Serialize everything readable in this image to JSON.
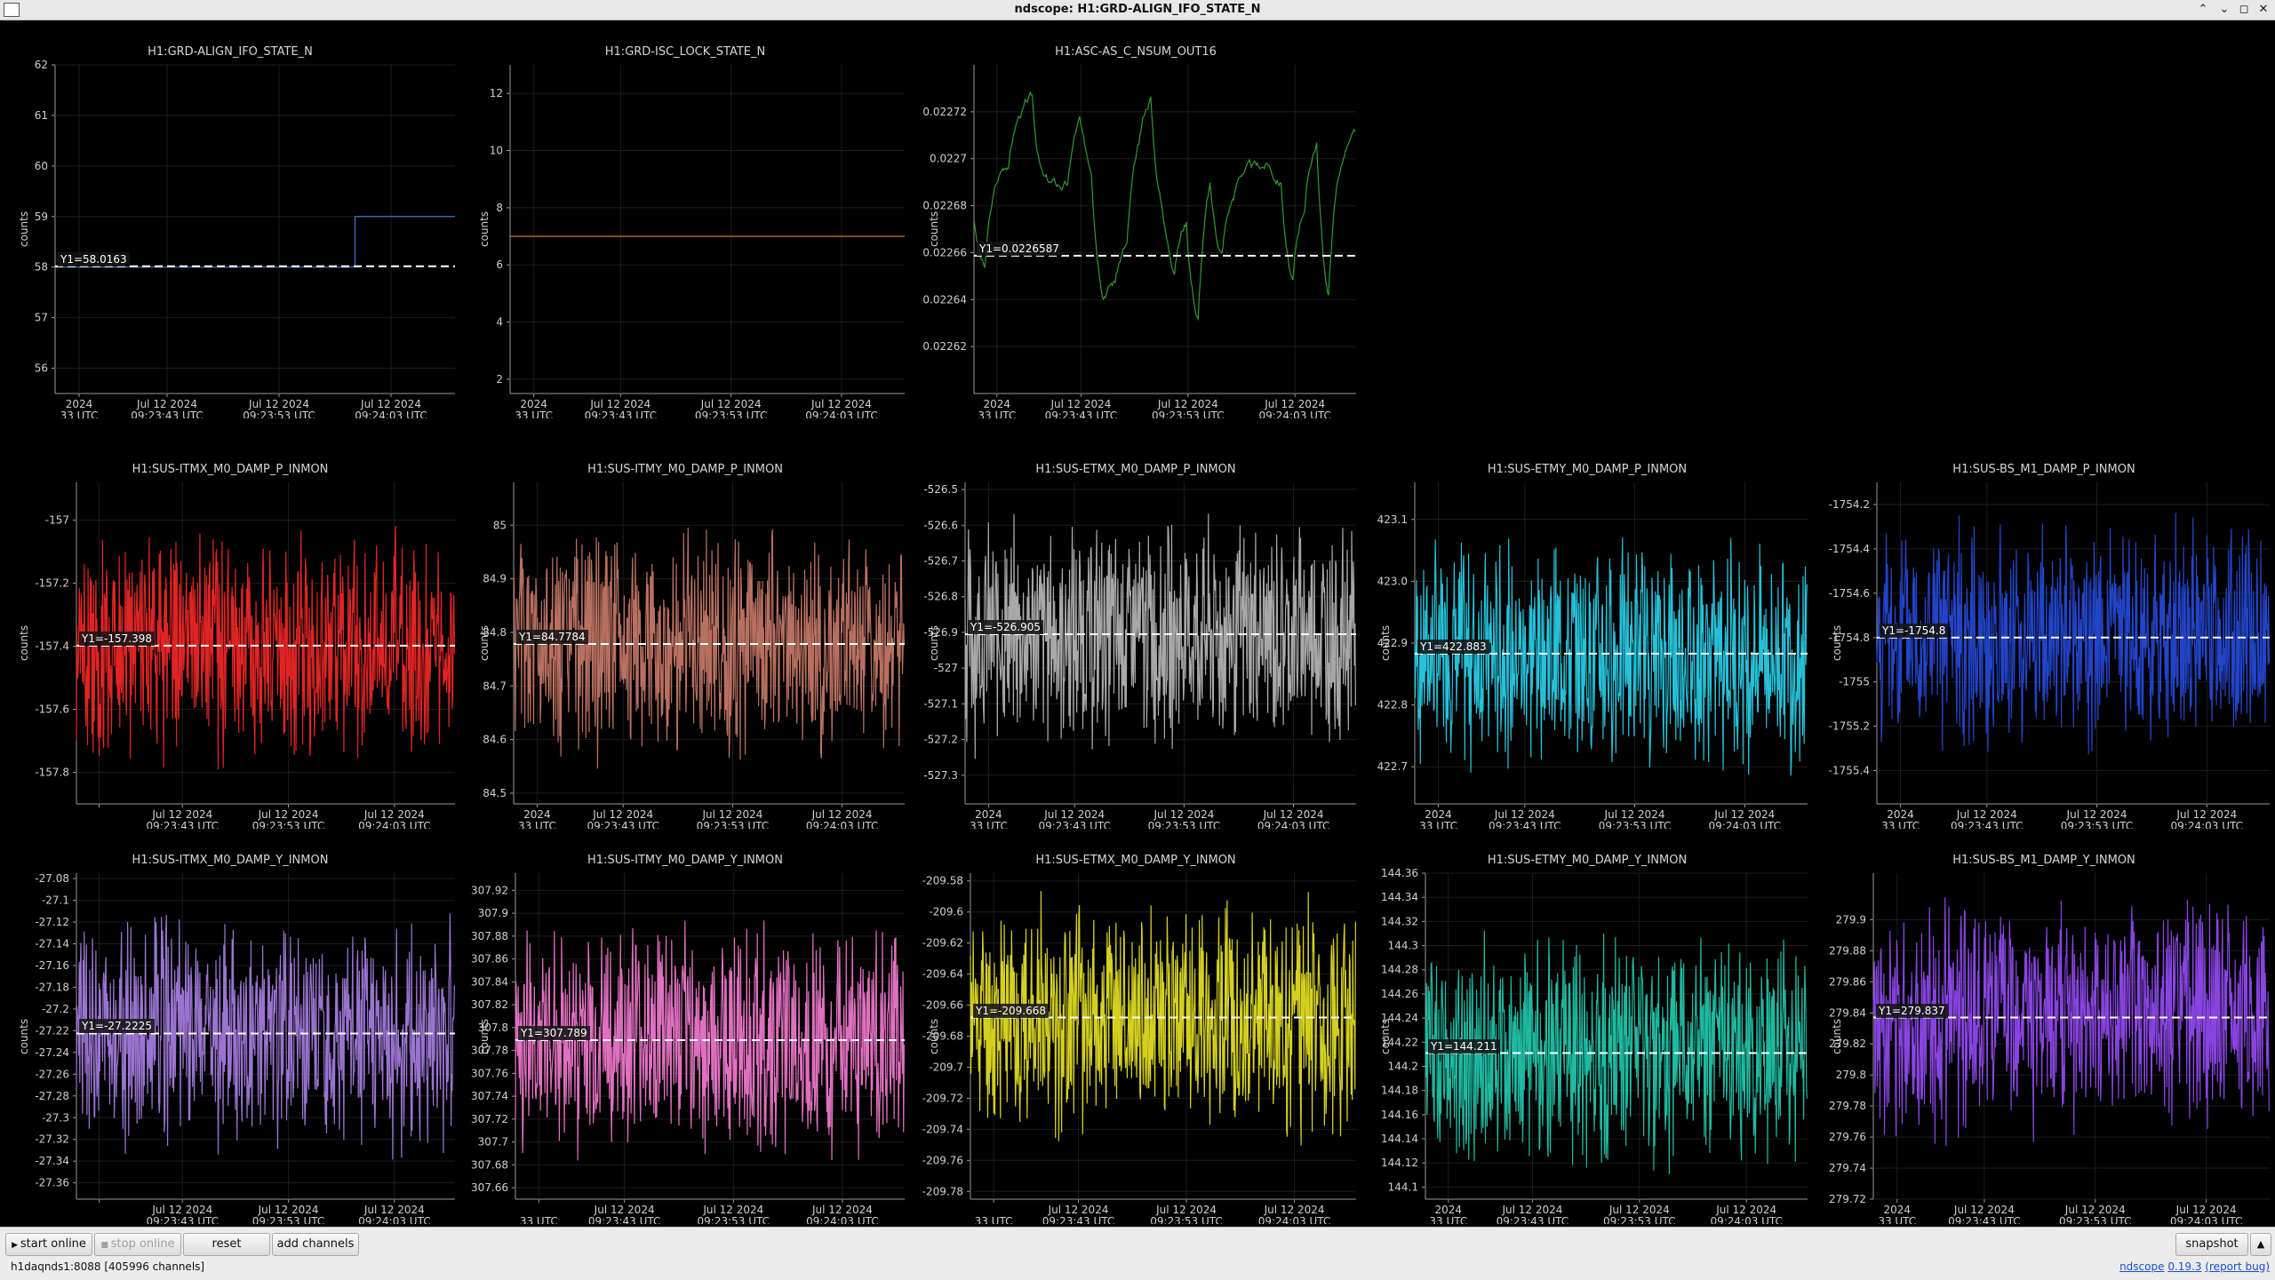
{
  "window": {
    "title": "ndscope: H1:GRD-ALIGN_IFO_STATE_N"
  },
  "ylabel_text": "counts",
  "plots": [
    {
      "title": "H1:GRD-ALIGN_IFO_STATE_N",
      "color": "#3f78c8",
      "kind": "step",
      "ymin": 55.5,
      "ymax": 62,
      "yticks": [
        "56",
        "57",
        "58",
        "59",
        "60",
        "61",
        "62"
      ],
      "cursor": 58.0163,
      "cursor_label": "Y1=58.0163",
      "seed": 1,
      "xticks": [
        "2024",
        "Jul 12 2024",
        "Jul 12 2024",
        "Jul 12 2024"
      ],
      "xsub": [
        "33 UTC",
        "09:23:43 UTC",
        "09:23:53 UTC",
        "09:24:03 UTC"
      ],
      "step_levels": [
        58,
        59
      ],
      "step_at": 0.75
    },
    {
      "title": "H1:GRD-ISC_LOCK_STATE_N",
      "color": "#e08a2a",
      "kind": "flat",
      "ymin": 1.5,
      "ymax": 13,
      "yticks": [
        "2",
        "4",
        "6",
        "8",
        "10",
        "12"
      ],
      "flat_value": 7,
      "cursor": null,
      "cursor_label": "",
      "seed": 2,
      "xticks": [
        "2024",
        "Jul 12 2024",
        "Jul 12 2024",
        "Jul 12 2024"
      ],
      "xsub": [
        "33 UTC",
        "09:23:43 UTC",
        "09:23:53 UTC",
        "09:24:03 UTC"
      ]
    },
    {
      "title": "H1:ASC-AS_C_NSUM_OUT16",
      "color": "#2f9a2f",
      "kind": "smooth",
      "ymin": 0.0226,
      "ymax": 0.02274,
      "yticks": [
        "0.02262",
        "0.02264",
        "0.02266",
        "0.02268",
        "0.0227",
        "0.02272"
      ],
      "cursor": 0.0226587,
      "cursor_label": "Y1=0.0226587",
      "seed": 3,
      "xticks": "2024",
      "xticks_list": [
        "2024",
        "Jul 12 2024",
        "Jul 12 2024",
        "Jul 12 2024"
      ],
      "xsub": [
        "33 UTC",
        "09:23:43 UTC",
        "09:23:53 UTC",
        "09:24:03 UTC"
      ]
    },
    {
      "title": "H1:SUS-ITMX_M0_DAMP_P_INMON",
      "color": "#e02424",
      "kind": "noise",
      "ymin": -157.9,
      "ymax": -156.88,
      "yticks": [
        "-157.8",
        "-157.6",
        "-157.4",
        "-157.2",
        "-157"
      ],
      "cursor": -157.398,
      "cursor_label": "Y1=-157.398",
      "seed": 4,
      "xticks": [
        "",
        "Jul 12 2024",
        "Jul 12 2024",
        "Jul 12 2024"
      ],
      "xsub": [
        "",
        "09:23:43 UTC",
        "09:23:53 UTC",
        "09:24:03 UTC"
      ]
    },
    {
      "title": "H1:SUS-ITMY_M0_DAMP_P_INMON",
      "color": "#b87060",
      "kind": "noise",
      "ymin": 84.48,
      "ymax": 85.08,
      "yticks": [
        "84.5",
        "84.6",
        "84.7",
        "84.8",
        "84.9",
        "85"
      ],
      "cursor": 84.7784,
      "cursor_label": "Y1=84.7784",
      "seed": 5,
      "xticks": [
        "2024",
        "Jul 12 2024",
        "Jul 12 2024",
        "Jul 12 2024"
      ],
      "xsub": [
        "33 UTC",
        "09:23:43 UTC",
        "09:23:53 UTC",
        "09:24:03 UTC"
      ]
    },
    {
      "title": "H1:SUS-ETMX_M0_DAMP_P_INMON",
      "color": "#a8a8a8",
      "kind": "noise",
      "ymin": -527.38,
      "ymax": -526.48,
      "yticks": [
        "-527.3",
        "-527.2",
        "-527.1",
        "-527",
        "-526.9",
        "-526.8",
        "-526.7",
        "-526.6",
        "-526.5"
      ],
      "cursor": -526.905,
      "cursor_label": "Y1=-526.905",
      "seed": 6,
      "xticks": [
        "2024",
        "Jul 12 2024",
        "Jul 12 2024",
        "Jul 12 2024"
      ],
      "xsub": [
        "33 UTC",
        "09:23:43 UTC",
        "09:23:53 UTC",
        "09:24:03 UTC"
      ]
    },
    {
      "title": "H1:SUS-ETMY_M0_DAMP_P_INMON",
      "color": "#26c0d8",
      "kind": "noise",
      "ymin": 422.64,
      "ymax": 423.16,
      "yticks": [
        "422.7",
        "422.8",
        "422.9",
        "423.0",
        "423.1"
      ],
      "cursor": 422.883,
      "cursor_label": "Y1=422.883",
      "seed": 7,
      "xticks": [
        "2024",
        "Jul 12 2024",
        "Jul 12 2024",
        "Jul 12 2024"
      ],
      "xsub": [
        "33 UTC",
        "09:23:43 UTC",
        "09:23:53 UTC",
        "09:24:03 UTC"
      ]
    },
    {
      "title": "H1:SUS-BS_M1_DAMP_P_INMON",
      "color": "#2244c8",
      "kind": "noise",
      "ymin": -1755.55,
      "ymax": -1754.1,
      "yticks": [
        "-1755.4",
        "-1755.2",
        "-1755",
        "-1754.8",
        "-1754.6",
        "-1754.4",
        "-1754.2"
      ],
      "cursor": -1754.8,
      "cursor_label": "Y1=-1754.8",
      "seed": 8,
      "xticks": [
        "2024",
        "Jul 12 2024",
        "Jul 12 2024",
        "Jul 12 2024"
      ],
      "xsub": [
        "33 UTC",
        "09:23:43 UTC",
        "09:23:53 UTC",
        "09:24:03 UTC"
      ]
    },
    {
      "title": "H1:SUS-ITMX_M0_DAMP_Y_INMON",
      "color": "#9a74d0",
      "kind": "noise",
      "ymin": -27.375,
      "ymax": -27.075,
      "yticks": [
        "-27.36",
        "-27.34",
        "-27.32",
        "-27.3",
        "-27.28",
        "-27.26",
        "-27.24",
        "-27.22",
        "-27.2",
        "-27.18",
        "-27.16",
        "-27.14",
        "-27.12",
        "-27.1",
        "-27.08"
      ],
      "cursor": -27.2225,
      "cursor_label": "Y1=-27.2225",
      "seed": 9,
      "xticks": [
        "",
        "Jul 12 2024",
        "Jul 12 2024",
        "Jul 12 2024"
      ],
      "xsub": [
        "",
        "09:23:43 UTC",
        "09:23:53 UTC",
        "09:24:03 UTC"
      ]
    },
    {
      "title": "H1:SUS-ITMY_M0_DAMP_Y_INMON",
      "color": "#e070c0",
      "kind": "noise",
      "ymin": 307.65,
      "ymax": 307.935,
      "yticks": [
        "307.66",
        "307.68",
        "307.7",
        "307.72",
        "307.74",
        "307.76",
        "307.78",
        "307.8",
        "307.82",
        "307.84",
        "307.86",
        "307.88",
        "307.9",
        "307.92"
      ],
      "cursor": 307.789,
      "cursor_label": "Y1=307.789",
      "seed": 10,
      "xticks": [
        "33 UTC",
        "09:23:43 UTC",
        "09:23:53 UTC",
        "09:24:03 UTC"
      ],
      "xsub": [
        "",
        "",
        "",
        ""
      ],
      "xtickline": [
        "",
        "Jul 12 2024",
        "Jul 12 2024",
        "Jul 12 2024"
      ]
    },
    {
      "title": "H1:SUS-ETMX_M0_DAMP_Y_INMON",
      "color": "#d4d020",
      "kind": "noise",
      "ymin": -209.785,
      "ymax": -209.575,
      "yticks": [
        "-209.78",
        "-209.76",
        "-209.74",
        "-209.72",
        "-209.7",
        "-209.68",
        "-209.66",
        "-209.64",
        "-209.62",
        "-209.6",
        "-209.58"
      ],
      "cursor": -209.668,
      "cursor_label": "Y1=-209.668",
      "seed": 11,
      "xticks": [
        "",
        "Jul 12 2024",
        "Jul 12 2024",
        "Jul 12 2024"
      ],
      "xsub": [
        "33 UTC",
        "09:23:43 UTC",
        "09:23:53 UTC",
        "09:24:03 UTC"
      ]
    },
    {
      "title": "H1:SUS-ETMY_M0_DAMP_Y_INMON",
      "color": "#1fb8a0",
      "kind": "noise",
      "ymin": 144.09,
      "ymax": 144.36,
      "yticks": [
        "144.1",
        "144.12",
        "144.14",
        "144.16",
        "144.18",
        "144.2",
        "144.22",
        "144.24",
        "144.26",
        "144.28",
        "144.3",
        "144.32",
        "144.34",
        "144.36"
      ],
      "cursor": 144.211,
      "cursor_label": "Y1=144.211",
      "seed": 12,
      "xticks": [
        "2024",
        "Jul 12 2024",
        "Jul 12 2024",
        "Jul 12 2024"
      ],
      "xsub": [
        "33 UTC",
        "09:23:43 UTC",
        "09:23:53 UTC",
        "09:24:03 UTC"
      ]
    },
    {
      "title": "H1:SUS-BS_M1_DAMP_Y_INMON",
      "color": "#8844e0",
      "kind": "noise",
      "ymin": 279.72,
      "ymax": 279.93,
      "yticks": [
        "279.72",
        "279.74",
        "279.76",
        "279.78",
        "279.8",
        "279.82",
        "279.84",
        "279.86",
        "279.88",
        "279.9"
      ],
      "cursor": 279.837,
      "cursor_label": "Y1=279.837",
      "seed": 13,
      "xticks": [
        "2024",
        "Jul 12 2024",
        "Jul 12 2024",
        "Jul 12 2024"
      ],
      "xsub": [
        "33 UTC",
        "09:23:43 UTC",
        "09:23:53 UTC",
        "09:24:03 UTC"
      ]
    }
  ],
  "buttons": {
    "start_online": "start online",
    "stop_online": "stop online",
    "reset": "reset",
    "add_channels": "add channels",
    "snapshot": "snapshot"
  },
  "status": {
    "server": "h1daqnds1:8088",
    "channels": "[405996 channels]"
  },
  "about": {
    "name": "ndscope",
    "version": "0.19.3",
    "report": "(report bug)"
  }
}
